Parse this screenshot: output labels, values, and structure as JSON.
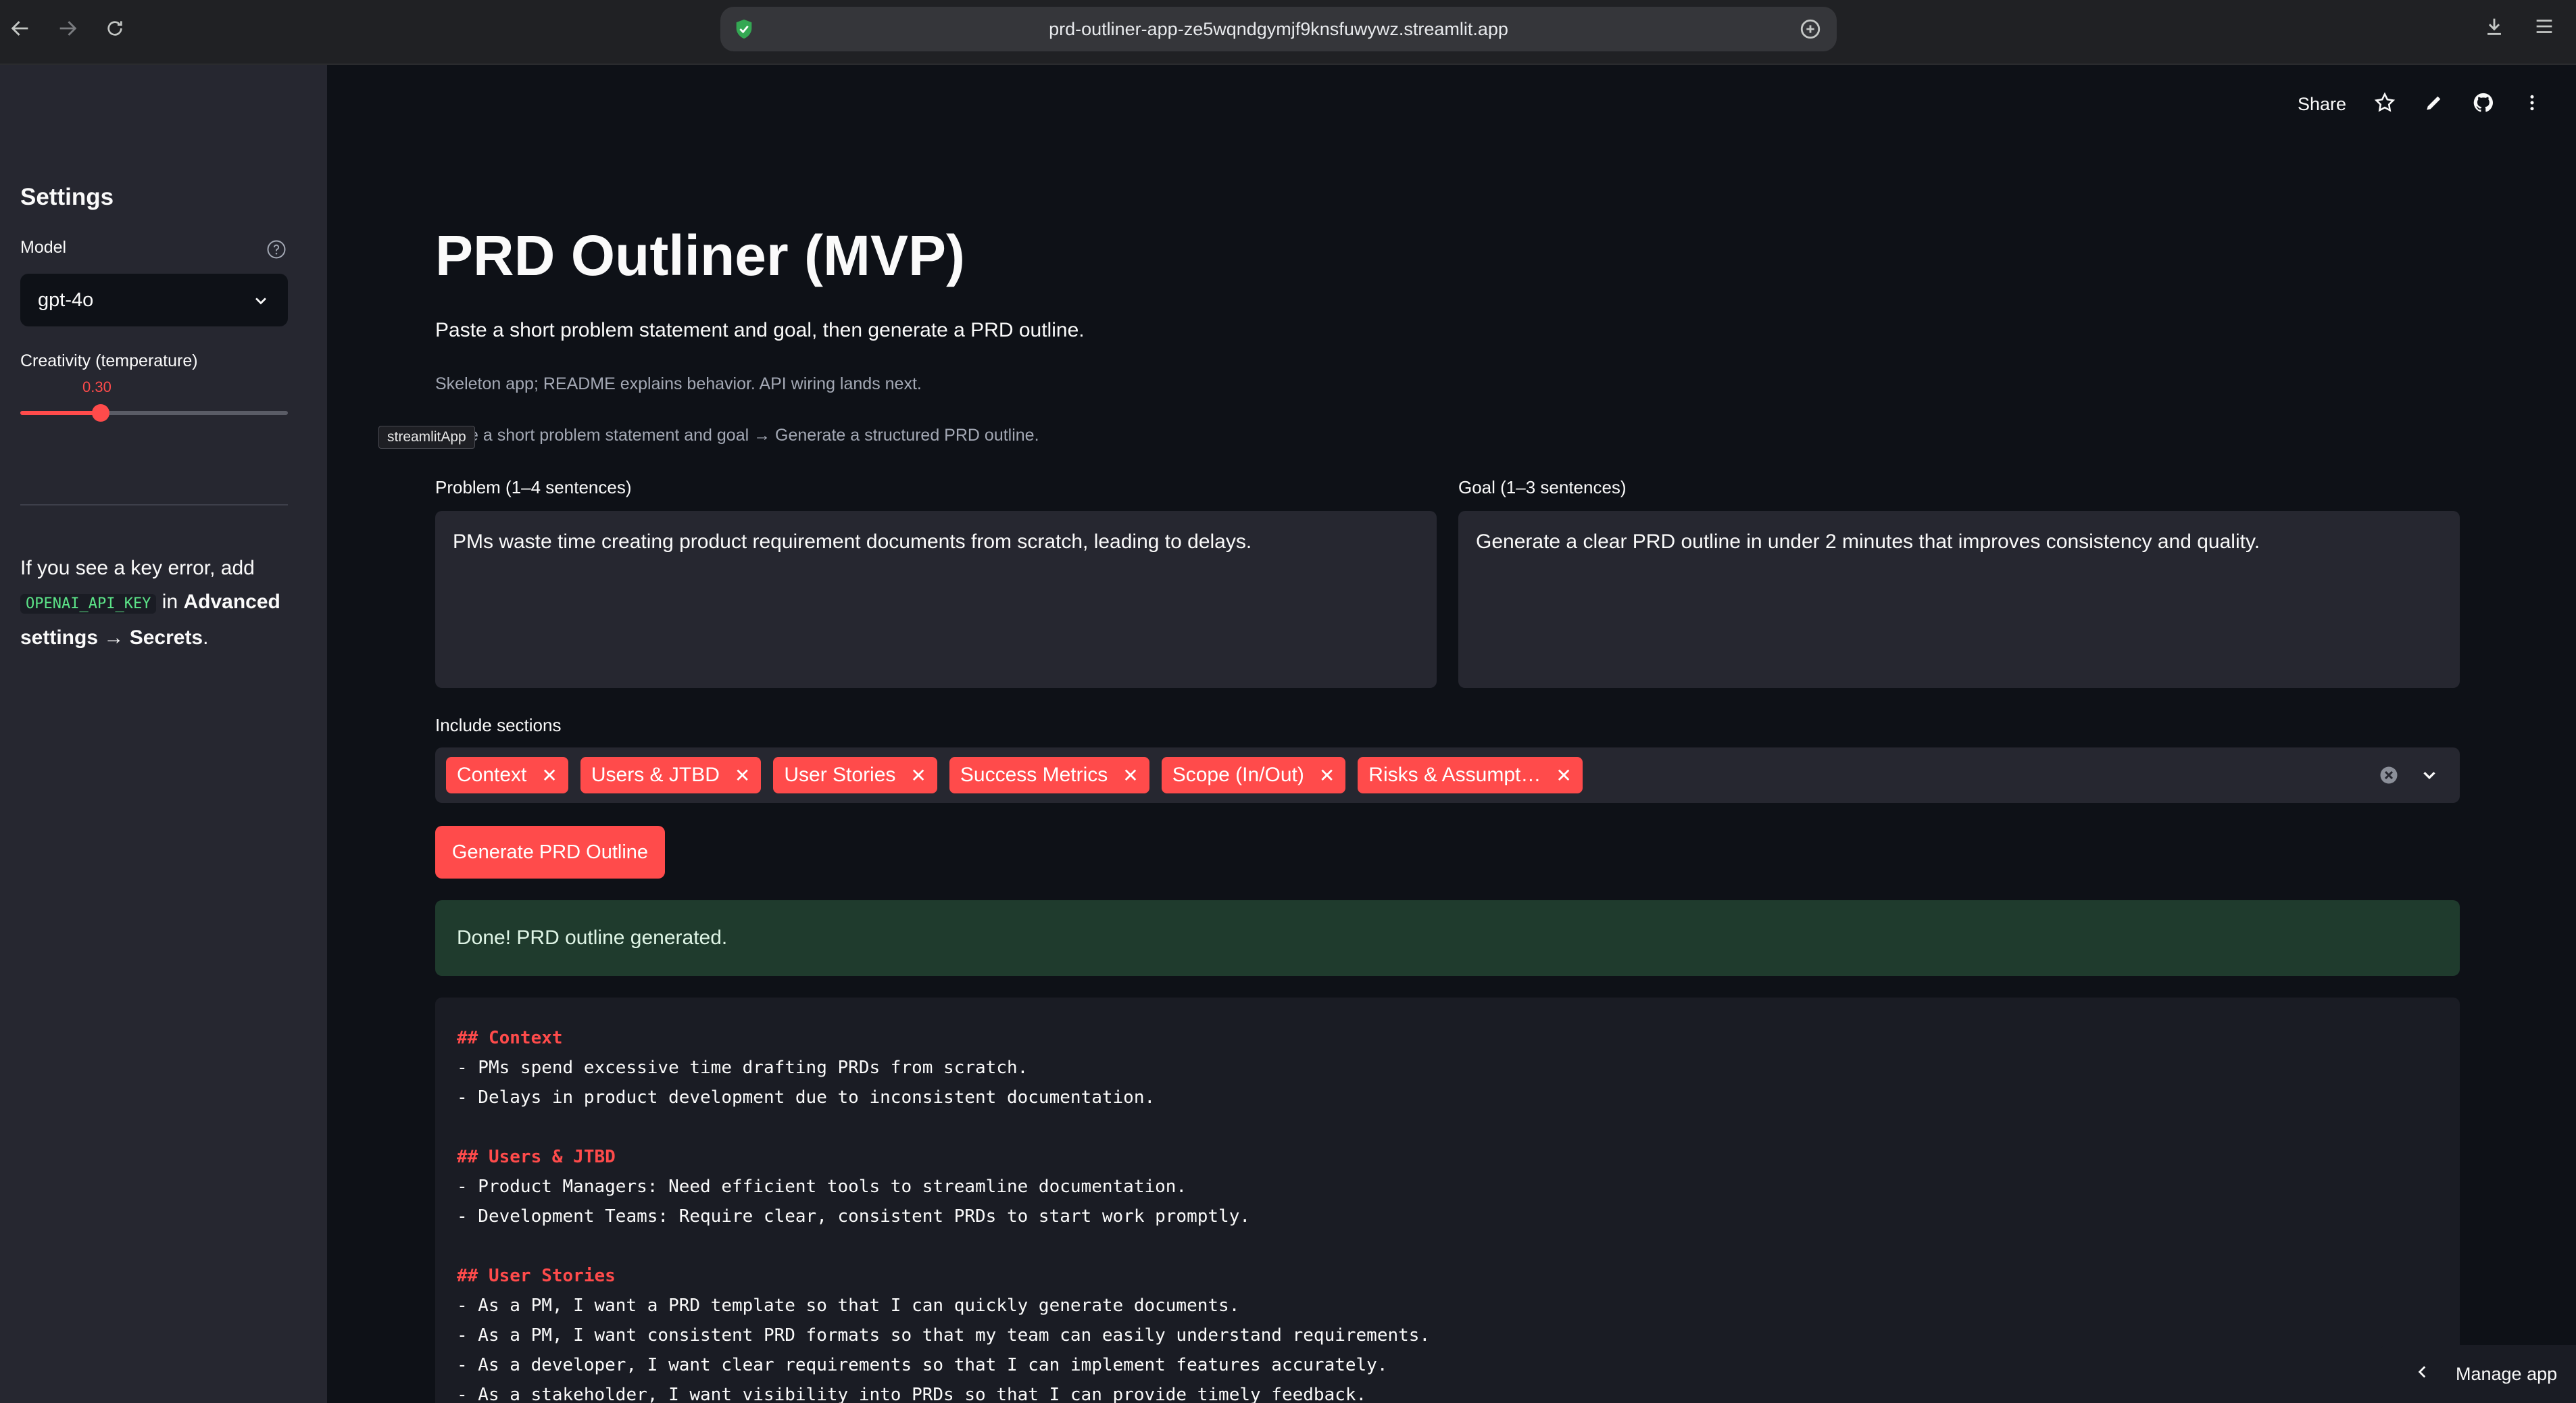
{
  "browser": {
    "url": "prd-outliner-app-ze5wqndgymjf9knsfuwywz.streamlit.app"
  },
  "sidebar": {
    "title": "Settings",
    "model_label": "Model",
    "model_value": "gpt-4o",
    "temperature_label": "Creativity (temperature)",
    "temperature_value": "0.30",
    "temperature_fraction": 0.3,
    "note_pre": "If you see a key error, add ",
    "note_code": "OPENAI_API_KEY",
    "note_mid": " in ",
    "note_bold1": "Advanced settings",
    "note_arrow": " → ",
    "note_bold2": "Secrets",
    "note_end": "."
  },
  "toolbar": {
    "share_label": "Share"
  },
  "main": {
    "title": "PRD Outliner (MVP)",
    "subtitle": "Paste a short problem statement and goal, then generate a PRD outline.",
    "caption1": "Skeleton app; README explains behavior. API wiring lands next.",
    "caption2": "Paste a short problem statement and goal → Generate a structured PRD outline.",
    "tooltip": "streamlitApp",
    "problem_label": "Problem (1–4 sentences)",
    "problem_value": "PMs waste time creating product requirement documents from scratch, leading to delays.",
    "goal_label": "Goal (1–3 sentences)",
    "goal_value": "Generate a clear PRD outline in under 2 minutes that improves consistency and quality.",
    "sections_label": "Include sections",
    "sections": [
      "Context",
      "Users & JTBD",
      "User Stories",
      "Success Metrics",
      "Scope (In/Out)",
      "Risks & Assumpt…"
    ],
    "generate_label": "Generate PRD Outline",
    "success_message": "Done! PRD outline generated."
  },
  "output": {
    "lines": [
      {
        "text": "## Context",
        "heading": true
      },
      {
        "text": "- PMs spend excessive time drafting PRDs from scratch.",
        "heading": false
      },
      {
        "text": "- Delays in product development due to inconsistent documentation.",
        "heading": false
      },
      {
        "text": "",
        "heading": false
      },
      {
        "text": "## Users & JTBD",
        "heading": true
      },
      {
        "text": "- Product Managers: Need efficient tools to streamline documentation.",
        "heading": false
      },
      {
        "text": "- Development Teams: Require clear, consistent PRDs to start work promptly.",
        "heading": false
      },
      {
        "text": "",
        "heading": false
      },
      {
        "text": "## User Stories",
        "heading": true
      },
      {
        "text": "- As a PM, I want a PRD template so that I can quickly generate documents.",
        "heading": false
      },
      {
        "text": "- As a PM, I want consistent PRD formats so that my team can easily understand requirements.",
        "heading": false
      },
      {
        "text": "- As a developer, I want clear requirements so that I can implement features accurately.",
        "heading": false
      },
      {
        "text": "- As a stakeholder, I want visibility into PRDs so that I can provide timely feedback.",
        "heading": false
      }
    ]
  },
  "manage": {
    "label": "Manage app"
  }
}
